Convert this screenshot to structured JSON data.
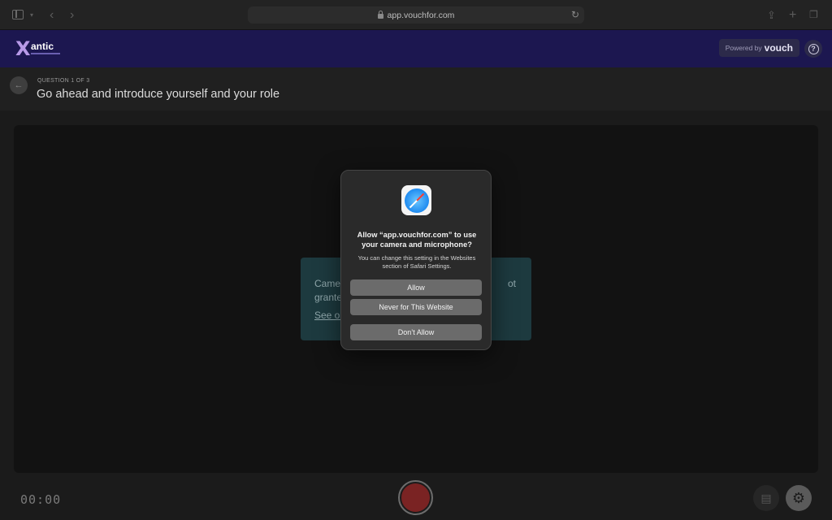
{
  "browser": {
    "url": "app.vouchfor.com",
    "reload_icon": "reload-icon"
  },
  "app_header": {
    "logo_text": "antic",
    "powered_label": "Powered by",
    "powered_brand": "vouch",
    "help_icon": "?"
  },
  "question": {
    "counter": "QUESTION 1 OF 3",
    "title": "Go ahead and introduce yourself and your role"
  },
  "notice": {
    "line1_start": "Camer",
    "line1_end": "ot",
    "line2": "grante",
    "link": "See ou"
  },
  "controls": {
    "timer": "00:00"
  },
  "dialog": {
    "title": "Allow “app.vouchfor.com” to use your camera and microphone?",
    "body": "You can change this setting in the Websites section of Safari Settings.",
    "allow": "Allow",
    "never": "Never for This Website",
    "deny": "Don’t Allow"
  },
  "colors": {
    "header_bg": "#1c1750",
    "notice_bg": "#1d3a3f",
    "record": "#7a2323"
  }
}
